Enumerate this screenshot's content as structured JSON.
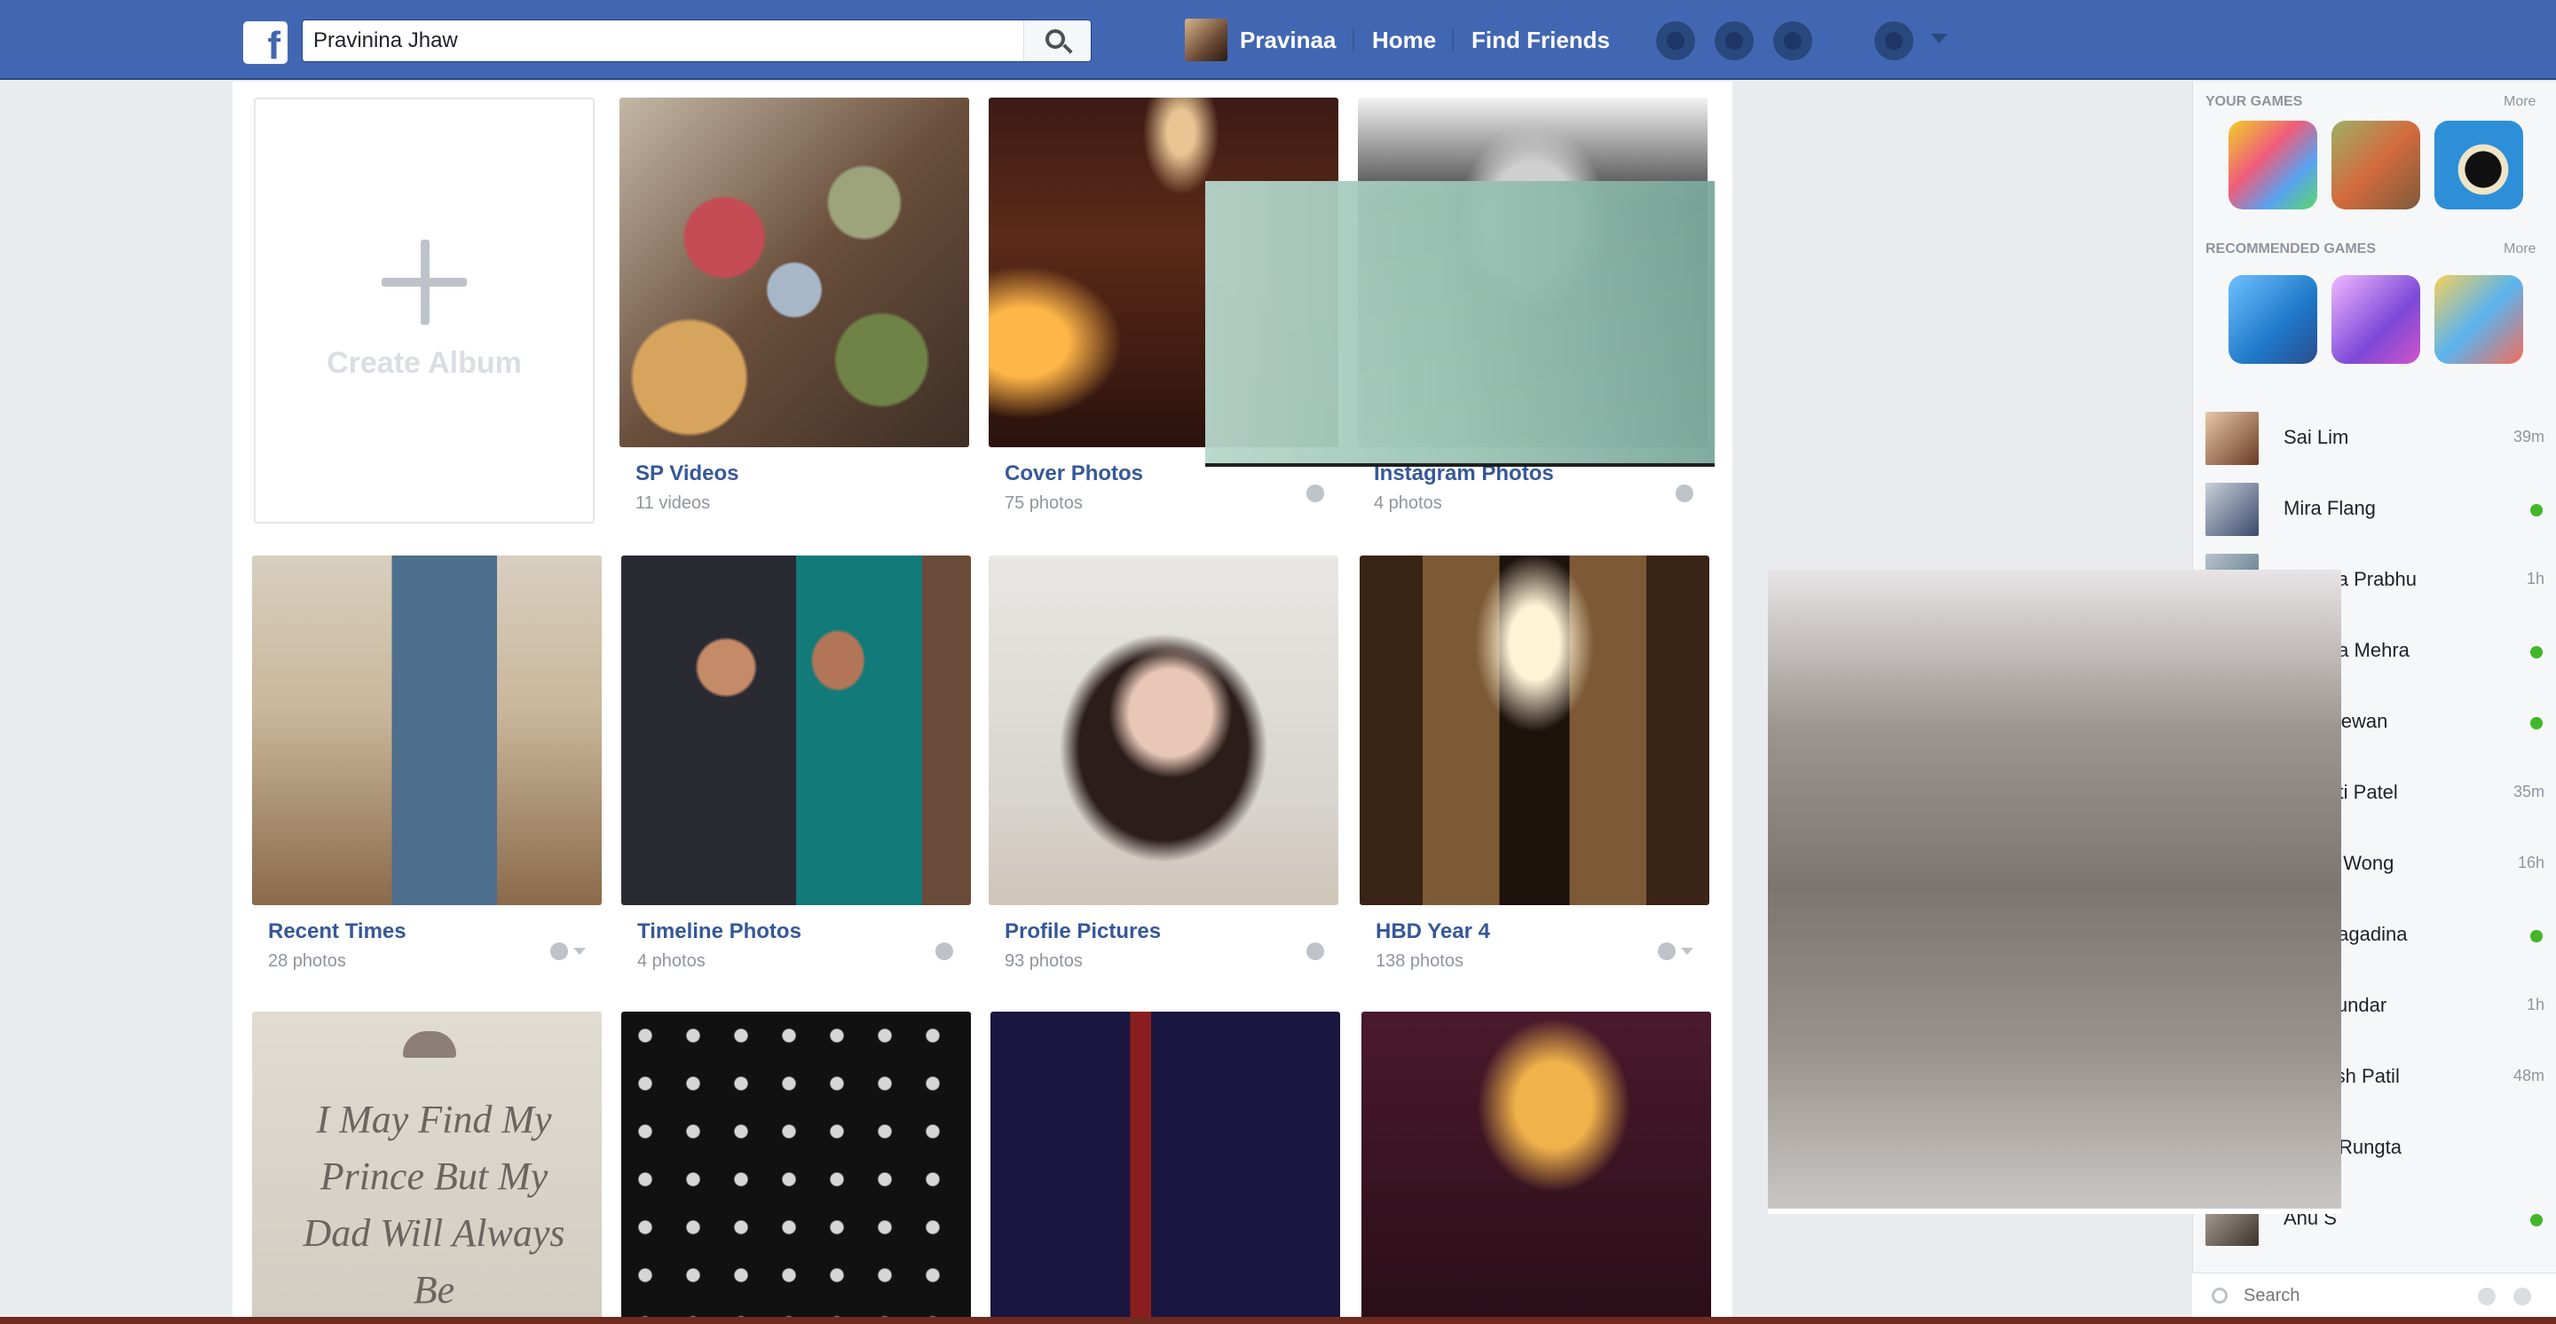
{
  "topbar": {
    "logo": "f",
    "search_placeholder": "Search",
    "search_value": "Pravinina Jhaw",
    "profile_name": "Pravinaa",
    "nav_home": "Home",
    "nav_find_friends": "Find Friends",
    "icons": [
      "friend-requests-icon",
      "messages-icon",
      "notifications-icon",
      "privacy-icon",
      "account-menu-caret"
    ]
  },
  "albums": {
    "create_label": "Create Album",
    "items": [
      {
        "name": "SP Videos",
        "count": "11 videos"
      },
      {
        "name": "Cover Photos",
        "count": "75 photos"
      },
      {
        "name": "Instagram Photos",
        "count": "4 photos"
      },
      {
        "name": "Recent Times",
        "count": "28 photos"
      },
      {
        "name": "Timeline Photos",
        "count": "4 photos"
      },
      {
        "name": "Profile Pictures",
        "count": "93 photos"
      },
      {
        "name": "HBD Year 4",
        "count": "138 photos"
      },
      {
        "name": "I May Find My Prince",
        "count": ""
      },
      {
        "name": "",
        "count": ""
      },
      {
        "name": "",
        "count": ""
      },
      {
        "name": "",
        "count": ""
      }
    ],
    "quote_text": "I May Find My Prince But My Dad Will Always Be"
  },
  "sidebar": {
    "your_games": "YOUR GAMES",
    "your_games_link": "More",
    "recommended_games": "RECOMMENDED GAMES",
    "recommended_games_link": "More",
    "contacts": [
      {
        "name": "Sai Lim",
        "status": "39m"
      },
      {
        "name": "Mira Flang",
        "status": "online"
      },
      {
        "name": "Yamina Prabhu",
        "status": "1h"
      },
      {
        "name": "Lahapa Mehra",
        "status": "online"
      },
      {
        "name": "Sujit Dewan",
        "status": "online"
      },
      {
        "name": "Tirupati Patel",
        "status": "35m"
      },
      {
        "name": "Kavita Wong",
        "status": "16h"
      },
      {
        "name": "Jina Sagadina",
        "status": "online"
      },
      {
        "name": "Ritu Sundar",
        "status": "1h"
      },
      {
        "name": "Ramesh Patil",
        "status": "48m"
      },
      {
        "name": "Vinod Rungta",
        "status": ""
      },
      {
        "name": "Anu S",
        "status": "online"
      }
    ],
    "chat_search_placeholder": "Search"
  }
}
